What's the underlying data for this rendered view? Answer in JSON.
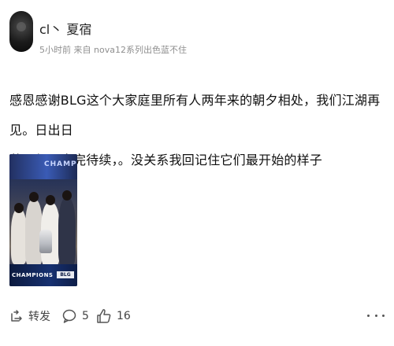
{
  "author": {
    "name": "cl丶 夏宿",
    "meta": "5小时前 来自 nova12系列出色蓝不住"
  },
  "post": {
    "line1": "感恩感谢BLG这个大家庭里所有人两年来的朝夕相处，我们江湖再见。日出日",
    "line2": "落，都是未完待续，。没关系我回记住它们最开始的样子"
  },
  "image": {
    "banner_text": "CHAMPI",
    "caption": "CHAMPIONS",
    "badge": "BLG"
  },
  "actions": {
    "share_label": "转发",
    "comment_count": "5",
    "like_count": "16"
  },
  "icons": {
    "share": "share-icon",
    "comment": "comment-icon",
    "like": "thumbs-up-icon",
    "more": "more-icon"
  }
}
